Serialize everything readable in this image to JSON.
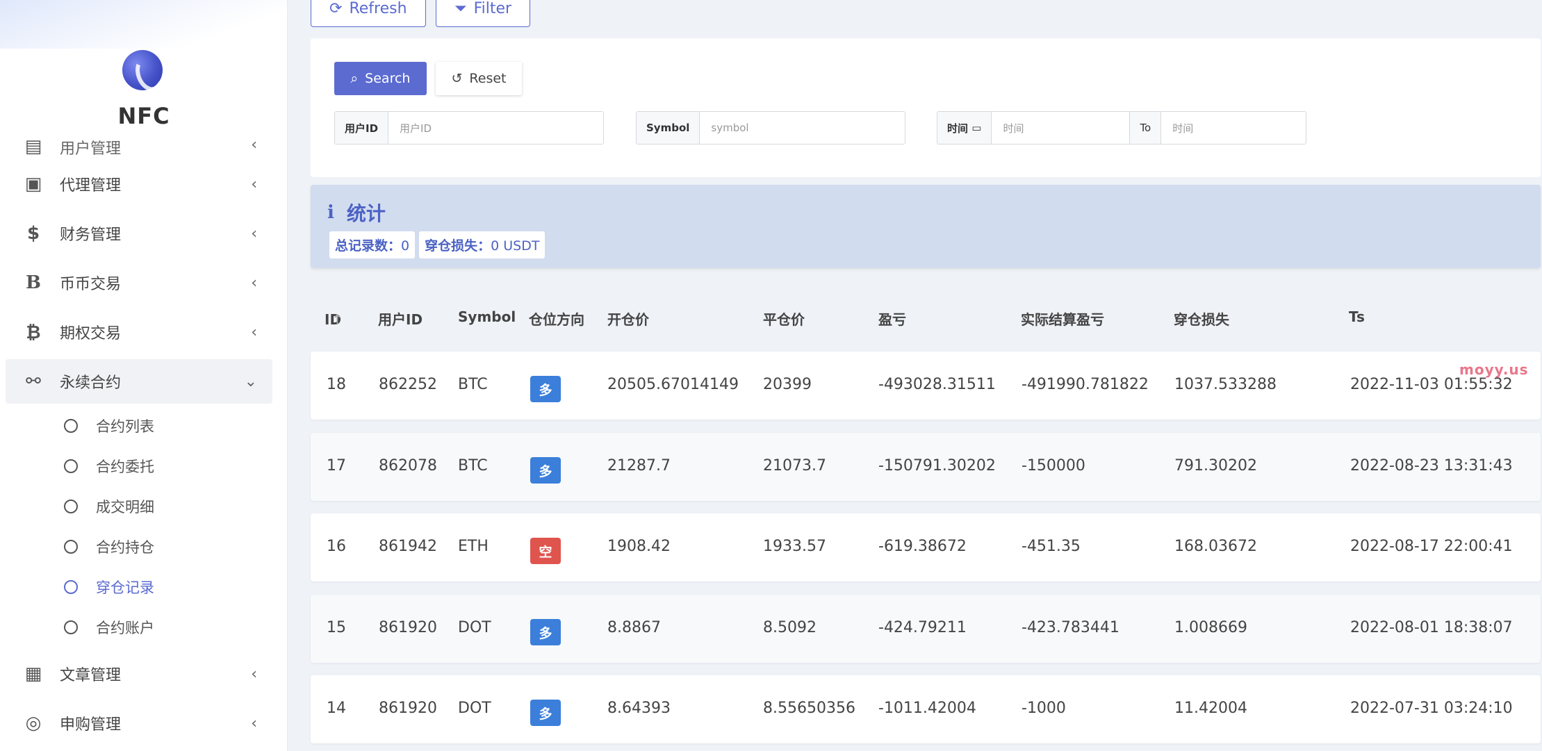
{
  "sidebar": {
    "brand": "NFC",
    "menu": [
      {
        "label": "用户管理",
        "icon": "users-icon"
      },
      {
        "label": "代理管理",
        "icon": "id-card-icon"
      },
      {
        "label": "财务管理",
        "icon": "dollar-icon"
      },
      {
        "label": "币币交易",
        "icon": "b-icon"
      },
      {
        "label": "期权交易",
        "icon": "bitcoin-icon"
      },
      {
        "label": "永续合约",
        "icon": "link-icon"
      },
      {
        "label": "文章管理",
        "icon": "newspaper-icon"
      },
      {
        "label": "申购管理",
        "icon": "lifebuoy-icon"
      }
    ],
    "submenu": [
      "合约列表",
      "合约委托",
      "成交明细",
      "合约持仓",
      "穿仓记录",
      "合约账户"
    ],
    "active_submenu": "穿仓记录"
  },
  "toolbar": {
    "refresh_label": "Refresh",
    "filter_label": "Filter"
  },
  "search": {
    "search_label": "Search",
    "reset_label": "Reset",
    "user_id_label": "用户ID",
    "user_id_placeholder": "用户ID",
    "symbol_label": "Symbol",
    "symbol_placeholder": "symbol",
    "time_label": "时间",
    "time_from_placeholder": "时间",
    "to_label": "To",
    "time_to_placeholder": "时间"
  },
  "stats": {
    "title": "统计",
    "total_label": "总记录数：",
    "total_value": "0",
    "loss_label": "穿仓损失：",
    "loss_value": "0 USDT"
  },
  "table": {
    "headers": [
      "ID",
      "用户ID",
      "Symbol",
      "仓位方向",
      "开仓价",
      "平仓价",
      "盈亏",
      "实际结算盈亏",
      "穿仓损失",
      "Ts"
    ],
    "rows": [
      {
        "id": "18",
        "uid": "862252",
        "symbol": "BTC",
        "side": "多",
        "side_type": "long",
        "open": "20505.67014149",
        "close": "20399",
        "pnl": "-493028.31511",
        "settled": "-491990.781822",
        "loss": "1037.533288",
        "ts": "2022-11-03 01:55:32"
      },
      {
        "id": "17",
        "uid": "862078",
        "symbol": "BTC",
        "side": "多",
        "side_type": "long",
        "open": "21287.7",
        "close": "21073.7",
        "pnl": "-150791.30202",
        "settled": "-150000",
        "loss": "791.30202",
        "ts": "2022-08-23 13:31:43"
      },
      {
        "id": "16",
        "uid": "861942",
        "symbol": "ETH",
        "side": "空",
        "side_type": "short",
        "open": "1908.42",
        "close": "1933.57",
        "pnl": "-619.38672",
        "settled": "-451.35",
        "loss": "168.03672",
        "ts": "2022-08-17 22:00:41"
      },
      {
        "id": "15",
        "uid": "861920",
        "symbol": "DOT",
        "side": "多",
        "side_type": "long",
        "open": "8.8867",
        "close": "8.5092",
        "pnl": "-424.79211",
        "settled": "-423.783441",
        "loss": "1.008669",
        "ts": "2022-08-01 18:38:07"
      },
      {
        "id": "14",
        "uid": "861920",
        "symbol": "DOT",
        "side": "多",
        "side_type": "long",
        "open": "8.64393",
        "close": "8.55650356",
        "pnl": "-1011.42004",
        "settled": "-1000",
        "loss": "11.42004",
        "ts": "2022-07-31 03:24:10"
      }
    ]
  },
  "watermark": "moyy.us",
  "colors": {
    "accent": "#5b6bd0",
    "long": "#3b7fdb",
    "short": "#e0544e",
    "stats_bg": "#d2dcef"
  }
}
